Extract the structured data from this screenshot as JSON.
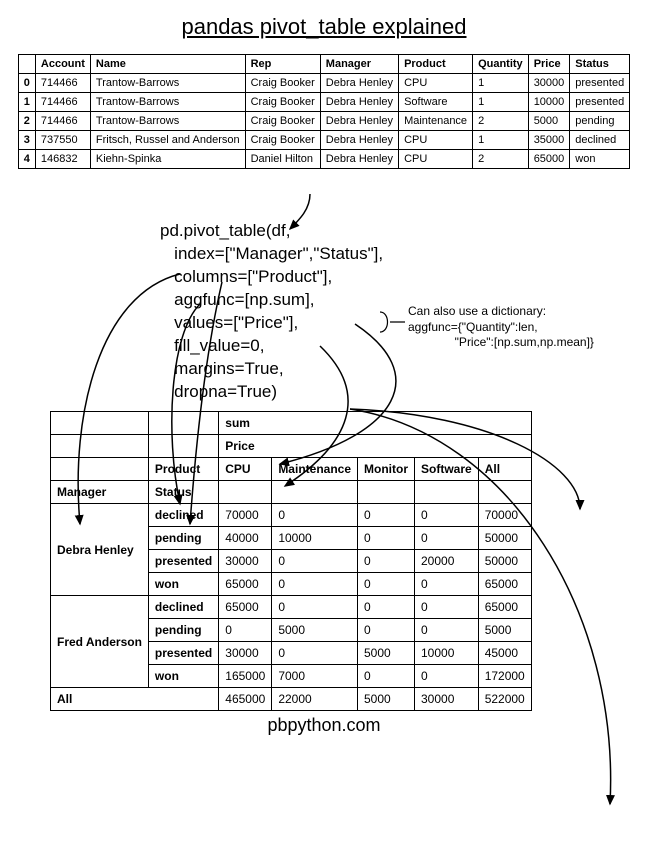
{
  "title": "pandas pivot_table explained",
  "footer": "pbpython.com",
  "source": {
    "headers": [
      "",
      "Account",
      "Name",
      "Rep",
      "Manager",
      "Product",
      "Quantity",
      "Price",
      "Status"
    ],
    "rows": [
      [
        "0",
        "714466",
        "Trantow-Barrows",
        "Craig Booker",
        "Debra Henley",
        "CPU",
        "1",
        "30000",
        "presented"
      ],
      [
        "1",
        "714466",
        "Trantow-Barrows",
        "Craig Booker",
        "Debra Henley",
        "Software",
        "1",
        "10000",
        "presented"
      ],
      [
        "2",
        "714466",
        "Trantow-Barrows",
        "Craig Booker",
        "Debra Henley",
        "Maintenance",
        "2",
        "5000",
        "pending"
      ],
      [
        "3",
        "737550",
        "Fritsch, Russel and Anderson",
        "Craig Booker",
        "Debra Henley",
        "CPU",
        "1",
        "35000",
        "declined"
      ],
      [
        "4",
        "146832",
        "Kiehn-Spinka",
        "Daniel Hilton",
        "Debra Henley",
        "CPU",
        "2",
        "65000",
        "won"
      ]
    ]
  },
  "code": {
    "l1": "pd.pivot_table(df,",
    "l2": "   index=[\"Manager\",\"Status\"],",
    "l3": "   columns=[\"Product\"],",
    "l4": "   aggfunc=[np.sum],",
    "l5": "   values=[\"Price\"],",
    "l6": "   fill_value=0,",
    "l7": "   margins=True,",
    "l8": "   dropna=True)"
  },
  "annotation": "Can also use a dictionary:\naggfunc={\"Quantity\":len,\n              \"Price\":[np.sum,np.mean]}",
  "pivot": {
    "agg_label": "sum",
    "value_label": "Price",
    "product_label": "Product",
    "manager_label": "Manager",
    "status_label": "Status",
    "all_label": "All",
    "products": [
      "CPU",
      "Maintenance",
      "Monitor",
      "Software",
      "All"
    ],
    "groups": [
      {
        "manager": "Debra Henley",
        "rows": [
          {
            "status": "declined",
            "vals": [
              "70000",
              "0",
              "0",
              "0",
              "70000"
            ]
          },
          {
            "status": "pending",
            "vals": [
              "40000",
              "10000",
              "0",
              "0",
              "50000"
            ]
          },
          {
            "status": "presented",
            "vals": [
              "30000",
              "0",
              "0",
              "20000",
              "50000"
            ]
          },
          {
            "status": "won",
            "vals": [
              "65000",
              "0",
              "0",
              "0",
              "65000"
            ]
          }
        ]
      },
      {
        "manager": "Fred Anderson",
        "rows": [
          {
            "status": "declined",
            "vals": [
              "65000",
              "0",
              "0",
              "0",
              "65000"
            ]
          },
          {
            "status": "pending",
            "vals": [
              "0",
              "5000",
              "0",
              "0",
              "5000"
            ]
          },
          {
            "status": "presented",
            "vals": [
              "30000",
              "0",
              "5000",
              "10000",
              "45000"
            ]
          },
          {
            "status": "won",
            "vals": [
              "165000",
              "7000",
              "0",
              "0",
              "172000"
            ]
          }
        ]
      }
    ],
    "totals": [
      "465000",
      "22000",
      "5000",
      "30000",
      "522000"
    ]
  }
}
